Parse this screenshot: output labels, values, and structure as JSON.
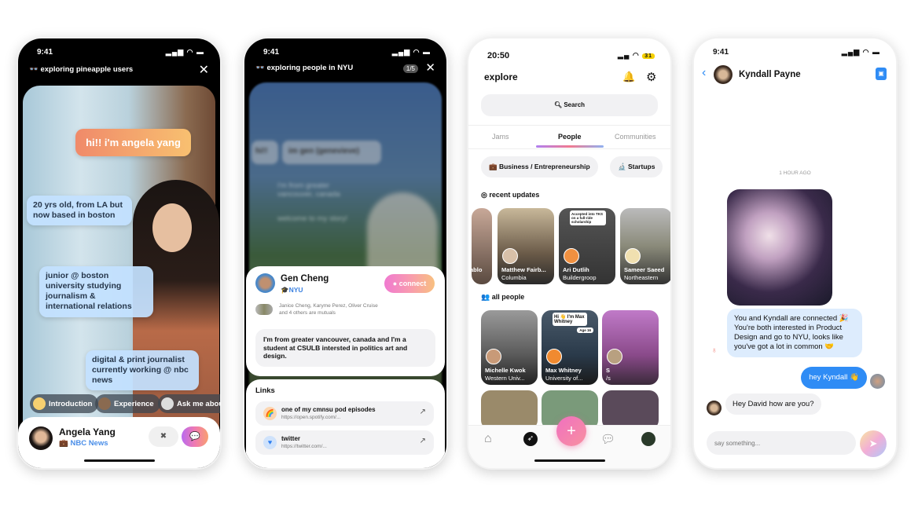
{
  "phone1": {
    "time": "9:41",
    "title": "exploring pineapple users",
    "bubbles": [
      "hi!! i'm angela yang",
      "20 yrs old, from LA but now based in boston",
      "junior @ boston university studying journalism & international relations",
      "digital & print journalist currently working @ nbc news"
    ],
    "chips": [
      "Introduction",
      "Experience",
      "Ask me about"
    ],
    "name": "Angela Yang",
    "company": "NBC News"
  },
  "phone2": {
    "time": "9:41",
    "title": "exploring people in NYU",
    "counter": "1/5",
    "blur_bubbles": [
      "hi!!",
      "im gen (genevieve)",
      "i'm from greater vancouver, canada",
      "welcome to my story!"
    ],
    "name": "Gen Cheng",
    "school": "NYU",
    "connect": "connect",
    "mutuals_line1": "Janice Cheng, Karyme Perez, Oliver Cruise",
    "mutuals_line2": "and 4 others are mutuals",
    "bio": "I'm from greater vancouver, canada and I'm a student at CSULB intersted in politics art and design.",
    "links_title": "Links",
    "links": [
      {
        "title": "one of my cmnsu pod episodes",
        "url": "https://open.spotify.com/..."
      },
      {
        "title": "twitter",
        "url": "https://twitter.com/..."
      }
    ]
  },
  "phone3": {
    "time": "20:50",
    "battery": "31",
    "title": "explore",
    "search": "Search",
    "tabs": [
      "Jams",
      "People",
      "Communities"
    ],
    "active_tab": "People",
    "chips": [
      "Business / Entrepreneurship",
      "Startups"
    ],
    "recent_title": "recent updates",
    "recent": [
      {
        "name": "ablo",
        "sub": ""
      },
      {
        "name": "Matthew Fairb...",
        "sub": "Columbia"
      },
      {
        "name": "Ari Dutlih",
        "sub": "Buildergroop",
        "caption": "Accepted into TKS on a full-ride scholarship"
      },
      {
        "name": "Sameer Saeed",
        "sub": "Northeastern"
      }
    ],
    "all_title": "all people",
    "people": [
      {
        "name": "Michelle Kwok",
        "sub": "Western Univ..."
      },
      {
        "name": "Max Whitney",
        "sub": "University of...",
        "caption": "Hi 👋 I'm Max Whitney",
        "tag": "Age 16"
      },
      {
        "name": "S",
        "sub": "/s"
      }
    ],
    "accent": "#f06fa8"
  },
  "phone4": {
    "time": "9:41",
    "contact": "Kyndall Payne",
    "timestamp": "1 HOUR AGO",
    "system_msg": "You and Kyndall are connected 🎉 You're both interested in Product Design and go to NYU, looks like you've got a lot in common 🤝",
    "sent": "hey Kyndall 👋",
    "received": "Hey David how are you?",
    "placeholder": "say something...",
    "accent": "#2f8cf5"
  }
}
